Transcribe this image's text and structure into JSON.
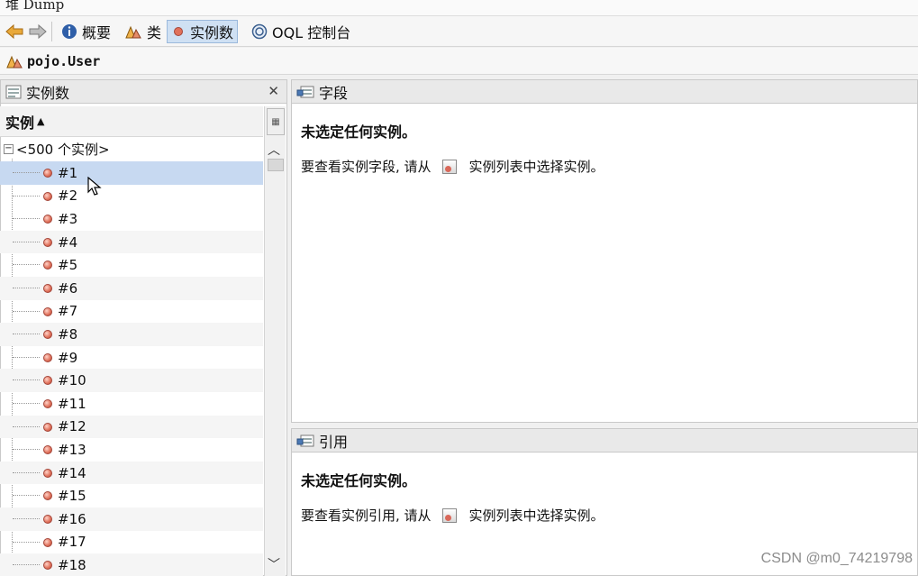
{
  "window": {
    "title": "堆 Dump"
  },
  "toolbar": {
    "back_label": "",
    "forward_label": "",
    "summary_label": "概要",
    "classes_label": "类",
    "instances_label": "实例数",
    "oql_label": "OQL 控制台"
  },
  "classbar": {
    "class_name": "pojo.User"
  },
  "instances_panel": {
    "title": "实例数",
    "column_header": "实例",
    "root_label": "<500 个实例>",
    "items": [
      "#1",
      "#2",
      "#3",
      "#4",
      "#5",
      "#6",
      "#7",
      "#8",
      "#9",
      "#10",
      "#11",
      "#12",
      "#13",
      "#14",
      "#15",
      "#16",
      "#17",
      "#18"
    ],
    "selected_index": 0
  },
  "fields_panel": {
    "title": "字段",
    "message_title": "未选定任何实例。",
    "message_prefix": "要查看实例字段, 请从",
    "message_suffix": "实例列表中选择实例。"
  },
  "references_panel": {
    "title": "引用",
    "message_title": "未选定任何实例。",
    "message_prefix": "要查看实例引用, 请从",
    "message_suffix": "实例列表中选择实例。"
  },
  "watermark": "CSDN @m0_74219798",
  "colors": {
    "selection": "#c7d9f1",
    "accent": "#e0705a"
  }
}
